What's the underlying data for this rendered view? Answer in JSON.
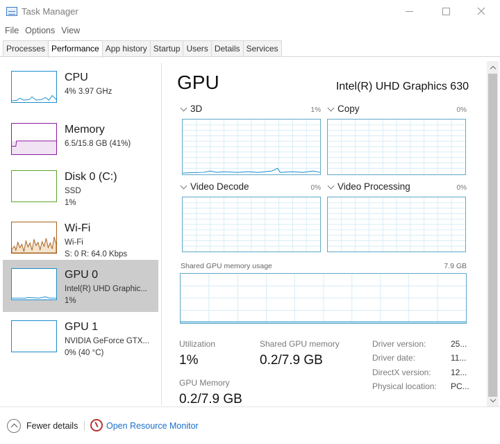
{
  "window": {
    "title": "Task Manager",
    "controls": {
      "minimize": "minimize-icon",
      "maximize": "maximize-icon",
      "close": "close-icon"
    }
  },
  "menu": [
    "File",
    "Options",
    "View"
  ],
  "tabs": [
    {
      "label": "Processes",
      "active": false
    },
    {
      "label": "Performance",
      "active": true
    },
    {
      "label": "App history",
      "active": false
    },
    {
      "label": "Startup",
      "active": false
    },
    {
      "label": "Users",
      "active": false
    },
    {
      "label": "Details",
      "active": false
    },
    {
      "label": "Services",
      "active": false
    }
  ],
  "sidebar": {
    "items": [
      {
        "name": "CPU",
        "line1": "4%  3.97 GHz",
        "line2": "",
        "color": "#1a8ccf"
      },
      {
        "name": "Memory",
        "line1": "6.5/15.8 GB (41%)",
        "line2": "",
        "color": "#8b1a9e"
      },
      {
        "name": "Disk 0 (C:)",
        "line1": "SSD",
        "line2": "1%",
        "color": "#5ca625"
      },
      {
        "name": "Wi-Fi",
        "line1": "Wi-Fi",
        "line2": "S: 0  R: 64.0 Kbps",
        "color": "#a6601a"
      },
      {
        "name": "GPU 0",
        "line1": "Intel(R) UHD Graphic...",
        "line2": "1%",
        "color": "#1a8ccf"
      },
      {
        "name": "GPU 1",
        "line1": "NVIDIA GeForce GTX...",
        "line2": "0%  (40 °C)",
        "color": "#1a8ccf"
      }
    ]
  },
  "detail": {
    "title": "GPU",
    "model": "Intel(R) UHD Graphics 630",
    "graphs": [
      {
        "label": "3D",
        "percent": "1%"
      },
      {
        "label": "Copy",
        "percent": "0%"
      },
      {
        "label": "Video Decode",
        "percent": "0%"
      },
      {
        "label": "Video Processing",
        "percent": "0%"
      }
    ],
    "shared_memory_label": "Shared GPU memory usage",
    "shared_memory_max": "7.9 GB",
    "stats": {
      "utilization_label": "Utilization",
      "utilization_value": "1%",
      "shared_gpu_memory_label": "Shared GPU memory",
      "shared_gpu_memory_value": "0.2/7.9 GB",
      "gpu_memory_label": "GPU Memory",
      "gpu_memory_value": "0.2/7.9 GB"
    },
    "properties": [
      {
        "key": "Driver version:",
        "value": "25..."
      },
      {
        "key": "Driver date:",
        "value": "11..."
      },
      {
        "key": "DirectX version:",
        "value": "12..."
      },
      {
        "key": "Physical location:",
        "value": "PC..."
      }
    ],
    "grid_color": "#d7ecf5",
    "graph_border_color": "#5fa8c8"
  },
  "footer": {
    "fewer_details": "Fewer details",
    "open_resource_monitor": "Open Resource Monitor"
  }
}
